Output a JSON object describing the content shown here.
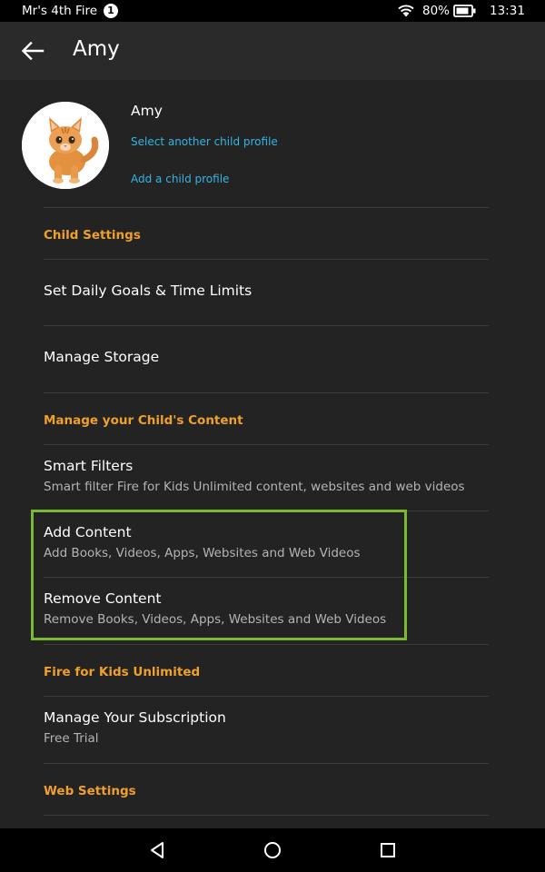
{
  "status_bar": {
    "device_name": "Mr's 4th Fire",
    "notification_count": "1",
    "battery_percent": "80%",
    "time": "13:31",
    "icons": [
      "wifi-icon",
      "battery-icon"
    ]
  },
  "header": {
    "back_icon": "back-arrow-icon",
    "title": "Amy"
  },
  "profile": {
    "name": "Amy",
    "avatar": "kitten-photo",
    "select_link": "Select another child profile",
    "add_link": "Add a child profile"
  },
  "sections": {
    "child_settings": {
      "header": "Child Settings",
      "items": [
        {
          "title": "Set Daily Goals & Time Limits"
        },
        {
          "title": "Manage Storage"
        }
      ]
    },
    "manage_content": {
      "header": "Manage your Child's Content",
      "items": [
        {
          "title": "Smart Filters",
          "subtitle": "Smart filter Fire for Kids Unlimited content, websites and web videos"
        },
        {
          "title": "Add Content",
          "subtitle": "Add Books, Videos, Apps, Websites and Web Videos"
        },
        {
          "title": "Remove Content",
          "subtitle": "Remove Books, Videos, Apps, Websites and Web Videos"
        }
      ]
    },
    "unlimited": {
      "header": "Fire for Kids Unlimited",
      "items": [
        {
          "title": "Manage Your Subscription",
          "subtitle": "Free Trial"
        }
      ]
    },
    "web_settings": {
      "header": "Web Settings"
    }
  },
  "colors": {
    "background": "#232323",
    "header_bg": "#2a2a2a",
    "section_header": "#f0a029",
    "link": "#33b5e5",
    "highlight_border": "#7ab932"
  },
  "nav_bar": {
    "icons": [
      "nav-back-icon",
      "nav-home-icon",
      "nav-recents-icon"
    ]
  }
}
